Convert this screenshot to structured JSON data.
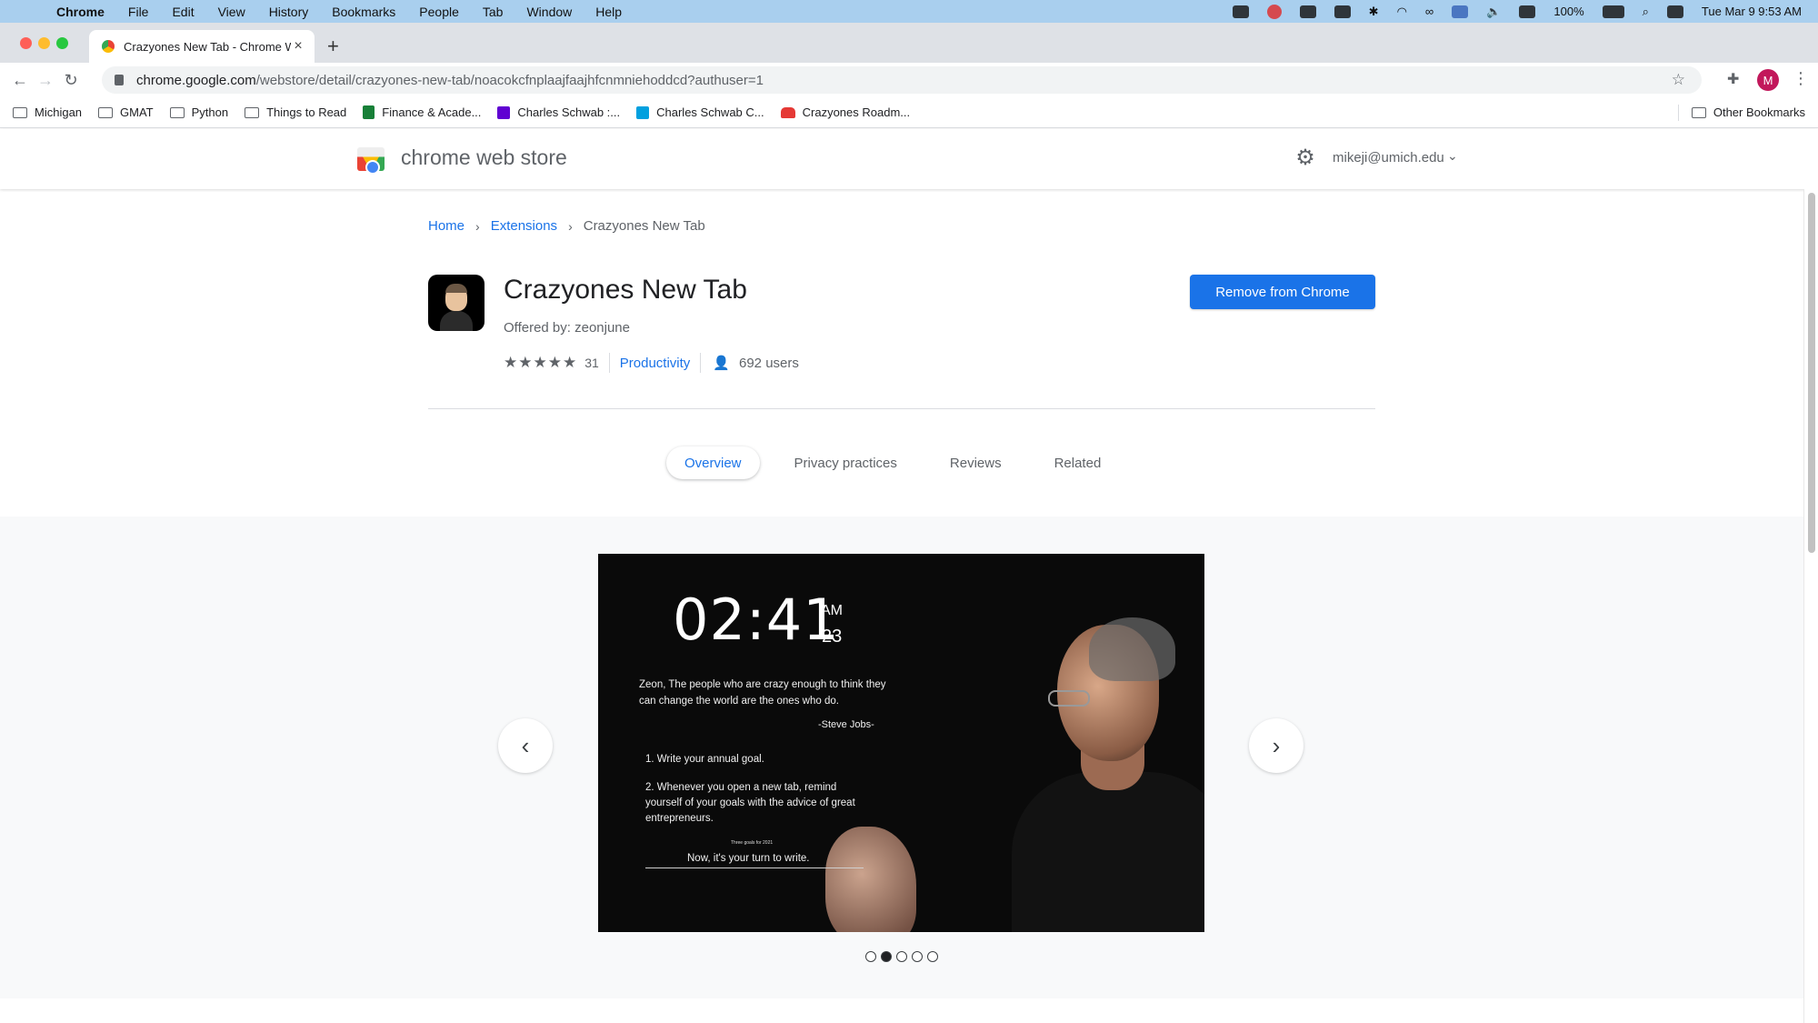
{
  "menubar": {
    "app": "Chrome",
    "items": [
      "File",
      "Edit",
      "View",
      "History",
      "Bookmarks",
      "People",
      "Tab",
      "Window",
      "Help"
    ],
    "battery": "100%",
    "datetime": "Tue Mar 9  9:53 AM"
  },
  "browser": {
    "tab_title": "Crazyones New Tab - Chrome Web Store",
    "url_host": "chrome.google.com",
    "url_path": "/webstore/detail/crazyones-new-tab/noacokcfnplaajfaajhfcnmniehoddcd?authuser=1",
    "profile_initial": "M",
    "bookmarks": [
      "Michigan",
      "GMAT",
      "Python",
      "Things to Read",
      "Finance & Acade...",
      "Charles Schwab :...",
      "Charles Schwab C...",
      "Crazyones Roadm..."
    ],
    "other_bookmarks": "Other Bookmarks"
  },
  "store": {
    "title": "chrome web store",
    "account": "mikeji@umich.edu"
  },
  "breadcrumb": {
    "home": "Home",
    "extensions": "Extensions",
    "current": "Crazyones New Tab"
  },
  "item": {
    "name": "Crazyones New Tab",
    "offered_by": "Offered by: zeonjune",
    "rating": 5,
    "rating_count": "31",
    "category": "Productivity",
    "users": "692 users",
    "action_button": "Remove from Chrome"
  },
  "tabs": [
    "Overview",
    "Privacy practices",
    "Reviews",
    "Related"
  ],
  "gallery": {
    "active_index": 1,
    "count": 5,
    "screenshot": {
      "clock": "02:41",
      "ampm": "AM",
      "seconds": "23",
      "quote": "Zeon, The people who are crazy enough to think they can change the world are the ones who do.",
      "author": "-Steve Jobs-",
      "goal1": "1. Write your annual goal.",
      "goal2": "2. Whenever you open a new tab, remind yourself of your goals with the advice of great entrepreneurs.",
      "small": "Three goals for 2021",
      "prompt": "Now, it's your turn to write."
    }
  }
}
